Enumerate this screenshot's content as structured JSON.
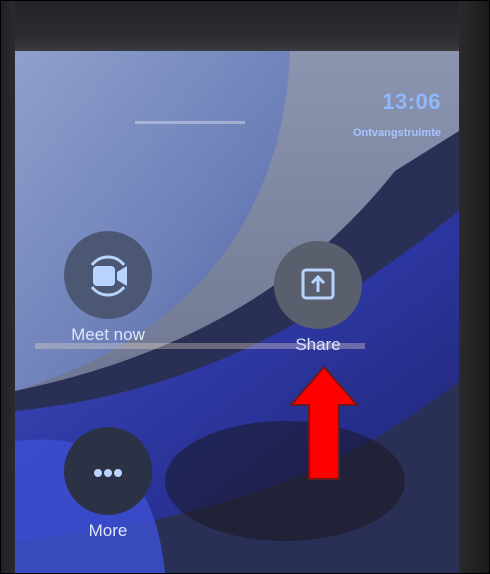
{
  "clock": {
    "time": "13:06",
    "room": "Ontvangstruimte"
  },
  "actions": {
    "meet_now": {
      "label": "Meet now",
      "icon": "video-camera-icon"
    },
    "share": {
      "label": "Share",
      "icon": "share-screen-icon"
    },
    "more": {
      "label": "More",
      "icon": "more-dots-icon"
    }
  },
  "annotation": {
    "icon": "red-arrow-up-icon",
    "color": "#ff0000"
  },
  "colors": {
    "accent": "#8fb6ff",
    "icon_blue": "#b9d4ff"
  }
}
